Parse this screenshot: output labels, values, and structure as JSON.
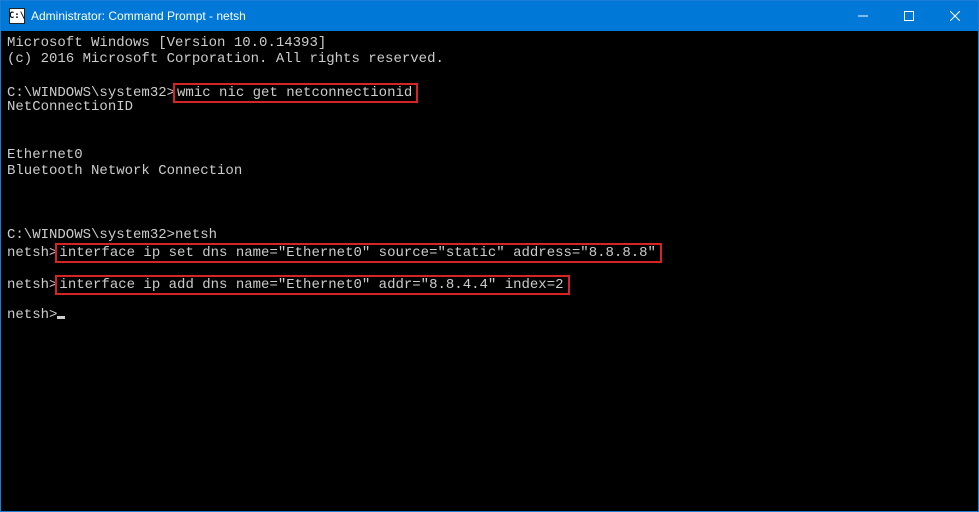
{
  "window": {
    "title": "Administrator: Command Prompt - netsh",
    "icon_label": "C:\\"
  },
  "terminal": {
    "lines": [
      {
        "text": "Microsoft Windows [Version 10.0.14393]"
      },
      {
        "text": "(c) 2016 Microsoft Corporation. All rights reserved."
      },
      {
        "text": ""
      },
      {
        "prompt": "C:\\WINDOWS\\system32>",
        "cmd": "wmic nic get netconnectionid",
        "highlight": true
      },
      {
        "text": "NetConnectionID"
      },
      {
        "text": ""
      },
      {
        "text": ""
      },
      {
        "text": "Ethernet0"
      },
      {
        "text": "Bluetooth Network Connection"
      },
      {
        "text": ""
      },
      {
        "text": ""
      },
      {
        "text": ""
      },
      {
        "prompt": "C:\\WINDOWS\\system32>",
        "cmd": "netsh"
      },
      {
        "prompt": "netsh>",
        "cmd": "interface ip set dns name=\"Ethernet0\" source=\"static\" address=\"8.8.8.8\"",
        "highlight": true
      },
      {
        "text": ""
      },
      {
        "prompt": "netsh>",
        "cmd": "interface ip add dns name=\"Ethernet0\" addr=\"8.8.4.4\" index=2",
        "highlight": true
      },
      {
        "text": ""
      },
      {
        "prompt": "netsh>",
        "cursor": true
      }
    ]
  }
}
